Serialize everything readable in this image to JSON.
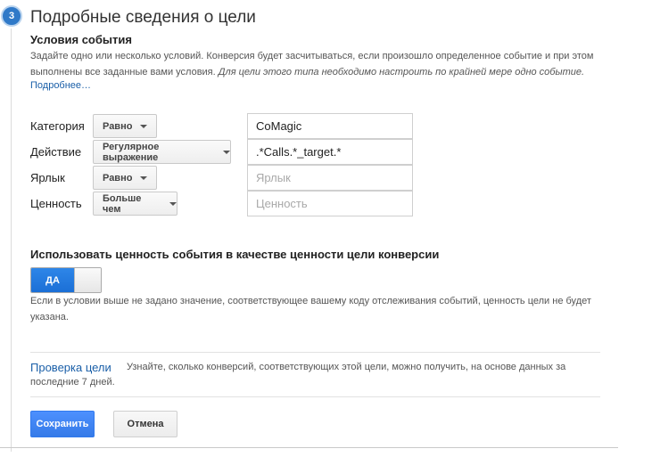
{
  "step": {
    "number": "3",
    "title": "Подробные сведения о цели"
  },
  "conditions": {
    "title": "Условия события",
    "description_plain": "Задайте одно или несколько условий. Конверсия будет засчитываться, если произошло определенное событие и при этом выполнены все заданные вами условия. ",
    "description_italic": "Для цели этого типа необходимо настроить по крайней мере одно событие.",
    "more_link": "Подробнее…"
  },
  "rows": [
    {
      "label": "Категория",
      "operator": "Равно",
      "value": "CoMagic",
      "placeholder": ""
    },
    {
      "label": "Действие",
      "operator": "Регулярное выражение",
      "value": ".*Calls.*_target.*",
      "placeholder": ""
    },
    {
      "label": "Ярлык",
      "operator": "Равно",
      "value": "",
      "placeholder": "Ярлык"
    },
    {
      "label": "Ценность",
      "operator": "Больше чем",
      "value": "",
      "placeholder": "Ценность"
    }
  ],
  "use_value": {
    "title": "Использовать ценность события в качестве ценности цели конверсии",
    "toggle_label": "ДА",
    "toggle_state": "on",
    "description": "Если в условии выше не задано значение, соответствующее вашему коду отслеживания событий, ценность цели не будет указана."
  },
  "verify": {
    "link": "Проверка цели",
    "text": "Узнайте, сколько конверсий, соответствующих этой цели, можно получить, на основе данных за последние 7 дней."
  },
  "buttons": {
    "save": "Сохранить",
    "cancel": "Отмена"
  },
  "colors": {
    "accent": "#1a73e8",
    "link": "#1a5fa8",
    "step_badge": "#2f79c8"
  }
}
